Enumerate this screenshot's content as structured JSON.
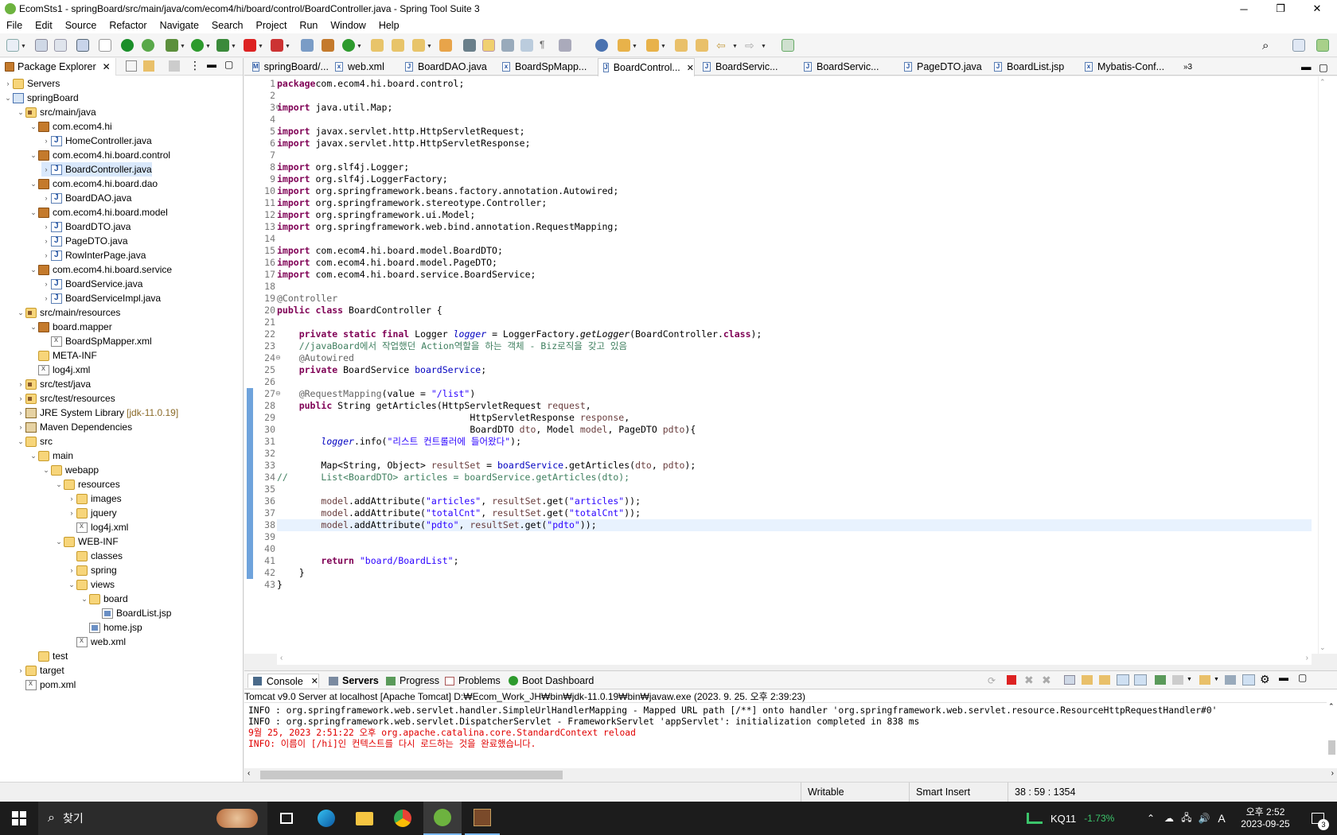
{
  "window": {
    "title": "EcomSts1 - springBoard/src/main/java/com/ecom4/hi/board/control/BoardController.java - Spring Tool Suite 3",
    "minimize": "─",
    "maximize": "❐",
    "close": "✕"
  },
  "menu": [
    "File",
    "Edit",
    "Source",
    "Refactor",
    "Navigate",
    "Search",
    "Project",
    "Run",
    "Window",
    "Help"
  ],
  "package_explorer": {
    "title": "Package Explorer",
    "items": [
      {
        "label": "Servers",
        "depth": 0,
        "twisty": "›",
        "icon": "folder"
      },
      {
        "label": "springBoard",
        "depth": 0,
        "twisty": "⌄",
        "icon": "proj"
      },
      {
        "label": "src/main/java",
        "depth": 1,
        "twisty": "⌄",
        "icon": "srcf"
      },
      {
        "label": "com.ecom4.hi",
        "depth": 2,
        "twisty": "⌄",
        "icon": "pkg"
      },
      {
        "label": "HomeController.java",
        "depth": 3,
        "twisty": "›",
        "icon": "java"
      },
      {
        "label": "com.ecom4.hi.board.control",
        "depth": 2,
        "twisty": "⌄",
        "icon": "pkg"
      },
      {
        "label": "BoardController.java",
        "depth": 3,
        "twisty": "›",
        "icon": "java",
        "selected": true
      },
      {
        "label": "com.ecom4.hi.board.dao",
        "depth": 2,
        "twisty": "⌄",
        "icon": "pkg"
      },
      {
        "label": "BoardDAO.java",
        "depth": 3,
        "twisty": "›",
        "icon": "java"
      },
      {
        "label": "com.ecom4.hi.board.model",
        "depth": 2,
        "twisty": "⌄",
        "icon": "pkg"
      },
      {
        "label": "BoardDTO.java",
        "depth": 3,
        "twisty": "›",
        "icon": "java"
      },
      {
        "label": "PageDTO.java",
        "depth": 3,
        "twisty": "›",
        "icon": "java"
      },
      {
        "label": "RowInterPage.java",
        "depth": 3,
        "twisty": "›",
        "icon": "java"
      },
      {
        "label": "com.ecom4.hi.board.service",
        "depth": 2,
        "twisty": "⌄",
        "icon": "pkg"
      },
      {
        "label": "BoardService.java",
        "depth": 3,
        "twisty": "›",
        "icon": "java"
      },
      {
        "label": "BoardServiceImpl.java",
        "depth": 3,
        "twisty": "›",
        "icon": "java"
      },
      {
        "label": "src/main/resources",
        "depth": 1,
        "twisty": "⌄",
        "icon": "srcf"
      },
      {
        "label": "board.mapper",
        "depth": 2,
        "twisty": "⌄",
        "icon": "pkg"
      },
      {
        "label": "BoardSpMapper.xml",
        "depth": 3,
        "twisty": "",
        "icon": "xml"
      },
      {
        "label": "META-INF",
        "depth": 2,
        "twisty": "",
        "icon": "folder"
      },
      {
        "label": "log4j.xml",
        "depth": 2,
        "twisty": "",
        "icon": "xml"
      },
      {
        "label": "src/test/java",
        "depth": 1,
        "twisty": "›",
        "icon": "srcf"
      },
      {
        "label": "src/test/resources",
        "depth": 1,
        "twisty": "›",
        "icon": "srcf"
      },
      {
        "label": "JRE System Library",
        "extra": "[jdk-11.0.19]",
        "depth": 1,
        "twisty": "›",
        "icon": "lib"
      },
      {
        "label": "Maven Dependencies",
        "depth": 1,
        "twisty": "›",
        "icon": "lib"
      },
      {
        "label": "src",
        "depth": 1,
        "twisty": "⌄",
        "icon": "folder"
      },
      {
        "label": "main",
        "depth": 2,
        "twisty": "⌄",
        "icon": "folder"
      },
      {
        "label": "webapp",
        "depth": 3,
        "twisty": "⌄",
        "icon": "folder"
      },
      {
        "label": "resources",
        "depth": 4,
        "twisty": "⌄",
        "icon": "folder"
      },
      {
        "label": "images",
        "depth": 5,
        "twisty": "›",
        "icon": "folder"
      },
      {
        "label": "jquery",
        "depth": 5,
        "twisty": "›",
        "icon": "folder"
      },
      {
        "label": "log4j.xml",
        "depth": 5,
        "twisty": "",
        "icon": "xml"
      },
      {
        "label": "WEB-INF",
        "depth": 4,
        "twisty": "⌄",
        "icon": "folder"
      },
      {
        "label": "classes",
        "depth": 5,
        "twisty": "",
        "icon": "folder"
      },
      {
        "label": "spring",
        "depth": 5,
        "twisty": "›",
        "icon": "folder"
      },
      {
        "label": "views",
        "depth": 5,
        "twisty": "⌄",
        "icon": "folder"
      },
      {
        "label": "board",
        "depth": 6,
        "twisty": "⌄",
        "icon": "folder"
      },
      {
        "label": "BoardList.jsp",
        "depth": 7,
        "twisty": "",
        "icon": "jsp"
      },
      {
        "label": "home.jsp",
        "depth": 6,
        "twisty": "",
        "icon": "jsp"
      },
      {
        "label": "web.xml",
        "depth": 5,
        "twisty": "",
        "icon": "xml"
      },
      {
        "label": "test",
        "depth": 2,
        "twisty": "",
        "icon": "folder"
      },
      {
        "label": "target",
        "depth": 1,
        "twisty": "›",
        "icon": "folder"
      },
      {
        "label": "pom.xml",
        "depth": 1,
        "twisty": "",
        "icon": "xml"
      }
    ]
  },
  "editor_tabs": [
    {
      "label": "springBoard/...",
      "icon": "M",
      "active": false
    },
    {
      "label": "web.xml",
      "icon": "x",
      "active": false
    },
    {
      "label": "BoardDAO.java",
      "icon": "J",
      "active": false
    },
    {
      "label": "BoardSpMapp...",
      "icon": "x",
      "active": false
    },
    {
      "label": "BoardControl...",
      "icon": "J",
      "active": true
    },
    {
      "label": "BoardServic...",
      "icon": "J",
      "active": false
    },
    {
      "label": "BoardServic...",
      "icon": "J",
      "active": false
    },
    {
      "label": "PageDTO.java",
      "icon": "J",
      "active": false
    },
    {
      "label": "BoardList.jsp",
      "icon": "J",
      "active": false
    },
    {
      "label": "Mybatis-Conf...",
      "icon": "x",
      "active": false
    }
  ],
  "editor_overflow": "»3",
  "code": {
    "current_line": 38,
    "fold_lines": [
      3,
      24,
      27
    ],
    "lines": [
      [
        [
          "kw",
          "package"
        ],
        [
          "",
          "com.ecom4.hi.board.control;"
        ]
      ],
      [],
      [
        [
          "kw",
          "import"
        ],
        [
          "",
          " java.util.Map;"
        ]
      ],
      [],
      [
        [
          "kw",
          "import"
        ],
        [
          "",
          " javax.servlet.http.HttpServletRequest;"
        ]
      ],
      [
        [
          "kw",
          "import"
        ],
        [
          "",
          " javax.servlet.http.HttpServletResponse;"
        ]
      ],
      [],
      [
        [
          "kw",
          "import"
        ],
        [
          "",
          " org.slf4j.Logger;"
        ]
      ],
      [
        [
          "kw",
          "import"
        ],
        [
          "",
          " org.slf4j.LoggerFactory;"
        ]
      ],
      [
        [
          "kw",
          "import"
        ],
        [
          "",
          " org.springframework.beans.factory.annotation.Autowired;"
        ]
      ],
      [
        [
          "kw",
          "import"
        ],
        [
          "",
          " org.springframework.stereotype.Controller;"
        ]
      ],
      [
        [
          "kw",
          "import"
        ],
        [
          "",
          " org.springframework.ui.Model;"
        ]
      ],
      [
        [
          "kw",
          "import"
        ],
        [
          "",
          " org.springframework.web.bind.annotation.RequestMapping;"
        ]
      ],
      [],
      [
        [
          "kw",
          "import"
        ],
        [
          "",
          " com.ecom4.hi.board.model.BoardDTO;"
        ]
      ],
      [
        [
          "kw",
          "import"
        ],
        [
          "",
          " com.ecom4.hi.board.model.PageDTO;"
        ]
      ],
      [
        [
          "kw",
          "import"
        ],
        [
          "",
          " com.ecom4.hi.board.service.BoardService;"
        ]
      ],
      [],
      [
        [
          "an",
          "@Controller"
        ]
      ],
      [
        [
          "kw",
          "public"
        ],
        [
          "",
          " "
        ],
        [
          "kw",
          "class"
        ],
        [
          "",
          " BoardController {"
        ]
      ],
      [],
      [
        [
          "",
          "    "
        ],
        [
          "kw",
          "private"
        ],
        [
          "",
          " "
        ],
        [
          "kw",
          "static"
        ],
        [
          "",
          " "
        ],
        [
          "kw",
          "final"
        ],
        [
          "",
          " Logger "
        ],
        [
          "fi",
          "logger"
        ],
        [
          "",
          " = LoggerFactory."
        ],
        [
          "mi",
          "getLogger"
        ],
        [
          "",
          "(BoardController."
        ],
        [
          "kw",
          "class"
        ],
        [
          "",
          ");"
        ]
      ],
      [
        [
          "",
          "    "
        ],
        [
          "cm",
          "//javaBoard에서 작업했던 Action역할을 하는 객체 - Biz로직을 갖고 있음"
        ]
      ],
      [
        [
          "",
          "    "
        ],
        [
          "an",
          "@Autowired"
        ]
      ],
      [
        [
          "",
          "    "
        ],
        [
          "kw",
          "private"
        ],
        [
          "",
          " BoardService "
        ],
        [
          "fld",
          "boardService"
        ],
        [
          "",
          ";"
        ]
      ],
      [],
      [
        [
          "",
          "    "
        ],
        [
          "an",
          "@RequestMapping"
        ],
        [
          "",
          "(value = "
        ],
        [
          "str",
          "\"/list\""
        ],
        [
          "",
          ")"
        ]
      ],
      [
        [
          "",
          "    "
        ],
        [
          "kw",
          "public"
        ],
        [
          "",
          " String getArticles(HttpServletRequest "
        ],
        [
          "lv",
          "request"
        ],
        [
          "",
          ","
        ]
      ],
      [
        [
          "",
          "                                   HttpServletResponse "
        ],
        [
          "lv",
          "response"
        ],
        [
          "",
          ","
        ]
      ],
      [
        [
          "",
          "                                   BoardDTO "
        ],
        [
          "lv",
          "dto"
        ],
        [
          "",
          ", Model "
        ],
        [
          "lv",
          "model"
        ],
        [
          "",
          ", PageDTO "
        ],
        [
          "lv",
          "pdto"
        ],
        [
          "",
          "){"
        ]
      ],
      [
        [
          "",
          "        "
        ],
        [
          "fi",
          "logger"
        ],
        [
          "",
          ".info("
        ],
        [
          "str",
          "\"리스트 컨트롤러에 들어왔다\""
        ],
        [
          "",
          ");"
        ]
      ],
      [],
      [
        [
          "",
          "        Map<String, Object> "
        ],
        [
          "lv",
          "resultSet"
        ],
        [
          "",
          " = "
        ],
        [
          "fld",
          "boardService"
        ],
        [
          "",
          ".getArticles("
        ],
        [
          "lv",
          "dto"
        ],
        [
          "",
          ", "
        ],
        [
          "lv",
          "pdto"
        ],
        [
          "",
          ");"
        ]
      ],
      [
        [
          "cm",
          "//      List<BoardDTO> articles = boardService.getArticles(dto);"
        ]
      ],
      [],
      [
        [
          "",
          "        "
        ],
        [
          "lv",
          "model"
        ],
        [
          "",
          ".addAttribute("
        ],
        [
          "str",
          "\"articles\""
        ],
        [
          "",
          ", "
        ],
        [
          "lv",
          "resultSet"
        ],
        [
          "",
          ".get("
        ],
        [
          "str",
          "\"articles\""
        ],
        [
          "",
          "));"
        ]
      ],
      [
        [
          "",
          "        "
        ],
        [
          "lv",
          "model"
        ],
        [
          "",
          ".addAttribute("
        ],
        [
          "str",
          "\"totalCnt\""
        ],
        [
          "",
          ", "
        ],
        [
          "lv",
          "resultSet"
        ],
        [
          "",
          ".get("
        ],
        [
          "str",
          "\"totalCnt\""
        ],
        [
          "",
          "));"
        ]
      ],
      [
        [
          "",
          "        "
        ],
        [
          "lv",
          "model"
        ],
        [
          "",
          ".addAttribute("
        ],
        [
          "str",
          "\"pdto\""
        ],
        [
          "",
          ", "
        ],
        [
          "lv",
          "resultSet"
        ],
        [
          "",
          ".get("
        ],
        [
          "str",
          "\"pdto\""
        ],
        [
          "",
          "));"
        ]
      ],
      [],
      [],
      [
        [
          "",
          "        "
        ],
        [
          "kw",
          "return"
        ],
        [
          "",
          " "
        ],
        [
          "str",
          "\"board/BoardList\""
        ],
        [
          "",
          ";"
        ]
      ],
      [
        [
          "",
          "    }"
        ]
      ],
      [
        [
          "",
          "}"
        ]
      ]
    ]
  },
  "bottom_tabs": [
    {
      "label": "Console",
      "active": true,
      "icon": "console-icon"
    },
    {
      "label": "Servers",
      "active": false,
      "icon": "servers-icon"
    },
    {
      "label": "Progress",
      "active": false,
      "icon": "progress-icon"
    },
    {
      "label": "Problems",
      "active": false,
      "icon": "problems-icon"
    },
    {
      "label": "Boot Dashboard",
      "active": false,
      "icon": "boot-dashboard-icon"
    }
  ],
  "console": {
    "header": "Tomcat v9.0 Server at localhost [Apache Tomcat] D:₩Ecom_Work_JH₩bin₩jdk-11.0.19₩bin₩javaw.exe  (2023. 9. 25. 오후 2:39:23)",
    "lines": [
      {
        "text": "INFO : org.springframework.web.servlet.handler.SimpleUrlHandlerMapping - Mapped URL path [/**] onto handler 'org.springframework.web.servlet.resource.ResourceHttpRequestHandler#0'",
        "error": false
      },
      {
        "text": "INFO : org.springframework.web.servlet.DispatcherServlet - FrameworkServlet 'appServlet': initialization completed in 838 ms",
        "error": false
      },
      {
        "text": "9월 25, 2023 2:51:22 오후 org.apache.catalina.core.StandardContext reload",
        "error": true
      },
      {
        "text": "INFO: 이름이 [/hi]인 컨텍스트를 다시 로드하는 것을 완료했습니다.",
        "error": true
      }
    ]
  },
  "status": {
    "writable": "Writable",
    "insert": "Smart Insert",
    "position": "38 : 59 : 1354"
  },
  "taskbar": {
    "search": "찾기",
    "stock_name": "KQ11",
    "stock_change": "-1.73%",
    "ime": "A",
    "time": "오후 2:52",
    "date": "2023-09-25",
    "notifications": "3"
  },
  "colors": {
    "keyword": "#7f0055",
    "string": "#2a00ff",
    "comment": "#3f7f5f",
    "annotation": "#646464",
    "field": "#0000c0",
    "console_error": "#e00000",
    "stock_negative": "#3cc56b"
  }
}
